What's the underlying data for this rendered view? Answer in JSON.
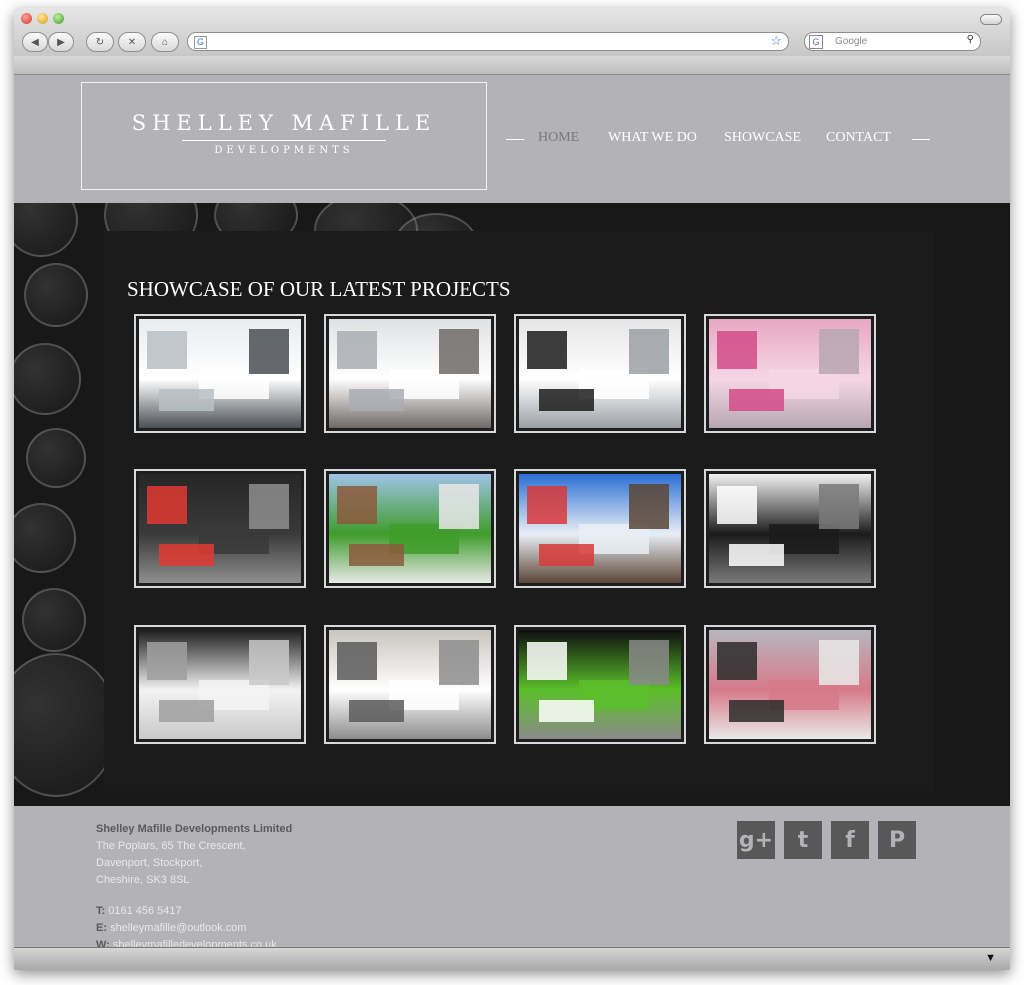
{
  "browser": {
    "search_placeholder": "Google",
    "back_label": "◀",
    "forward_label": "▶",
    "reload_label": "↻",
    "stop_label": "✕",
    "home_label": "⌂"
  },
  "logo": {
    "name": "Shelley Mafille",
    "tagline": "Developments"
  },
  "nav": {
    "items": [
      {
        "label": "HOME",
        "active": true
      },
      {
        "label": "WHAT WE DO",
        "active": false
      },
      {
        "label": "SHOWCASE",
        "active": false
      },
      {
        "label": "CONTACT",
        "active": false
      }
    ]
  },
  "showcase": {
    "title": "SHOWCASE OF OUR LATEST PROJECTS",
    "thumbnails": [
      {
        "subject": "white kitchen with island",
        "palette": [
          "#e9ecef",
          "#ffffff",
          "#b7bfc5",
          "#4a4f55"
        ]
      },
      {
        "subject": "white bathroom with freestanding bath",
        "palette": [
          "#dfe2e4",
          "#ffffff",
          "#a9aeb3",
          "#6d6a66"
        ]
      },
      {
        "subject": "black and white kitchen",
        "palette": [
          "#e6e6e6",
          "#ffffff",
          "#1c1c1c",
          "#9ba0a5"
        ]
      },
      {
        "subject": "pink bedroom",
        "palette": [
          "#e7a8c3",
          "#f6d6e4",
          "#d24b8a",
          "#b7a7b3"
        ]
      },
      {
        "subject": "black kitchen with red stools",
        "palette": [
          "#262626",
          "#3a3a3a",
          "#e23a32",
          "#8e8e8e"
        ]
      },
      {
        "subject": "garden with lawn",
        "palette": [
          "#9fc3e6",
          "#3f9c2c",
          "#8b5a3c",
          "#e8e8e8"
        ]
      },
      {
        "subject": "blue children's bedroom",
        "palette": [
          "#2b6fd3",
          "#e9eef5",
          "#d83a3a",
          "#5a4636"
        ]
      },
      {
        "subject": "white lounge with patterned wall",
        "palette": [
          "#f2f2f2",
          "#1b1b1b",
          "#ffffff",
          "#7a7a7a"
        ]
      },
      {
        "subject": "black and white living room",
        "palette": [
          "#1e1e1e",
          "#f3f3f3",
          "#9f9f9f",
          "#c9c9c9"
        ]
      },
      {
        "subject": "grey bedroom",
        "palette": [
          "#c9c5c0",
          "#ffffff",
          "#5a5a5a",
          "#8d8d8d"
        ]
      },
      {
        "subject": "black bedroom with green wall",
        "palette": [
          "#0f0f0f",
          "#5bbf2a",
          "#ffffff",
          "#8a8a8a"
        ]
      },
      {
        "subject": "dining room with pink wall",
        "palette": [
          "#b7b7bf",
          "#d67a88",
          "#2b2b2b",
          "#e9e9e9"
        ]
      }
    ]
  },
  "footer": {
    "company": "Shelley Mafille Developments Limited",
    "address_line1": "The Poplars, 65 The Crescent,",
    "address_line2": "Davenport, Stockport,",
    "address_line3": "Cheshire, SK3 8SL",
    "phone_label": "T:",
    "phone": "0161 456 5417",
    "email_label": "E:",
    "email": "shelleymafille@outlook.com",
    "web_label": "W:",
    "web": "shelleymafilledevelopments.co.uk",
    "social": [
      {
        "icon": "google-plus-icon",
        "glyph": "g+"
      },
      {
        "icon": "twitter-icon",
        "glyph": "t"
      },
      {
        "icon": "facebook-icon",
        "glyph": "f"
      },
      {
        "icon": "pinterest-icon",
        "glyph": "P"
      }
    ]
  },
  "colors": {
    "header_bg": "#b3b2b6",
    "hero_bg": "#181818",
    "nav_active": "#7a7a7a",
    "social_bg": "#585858"
  }
}
